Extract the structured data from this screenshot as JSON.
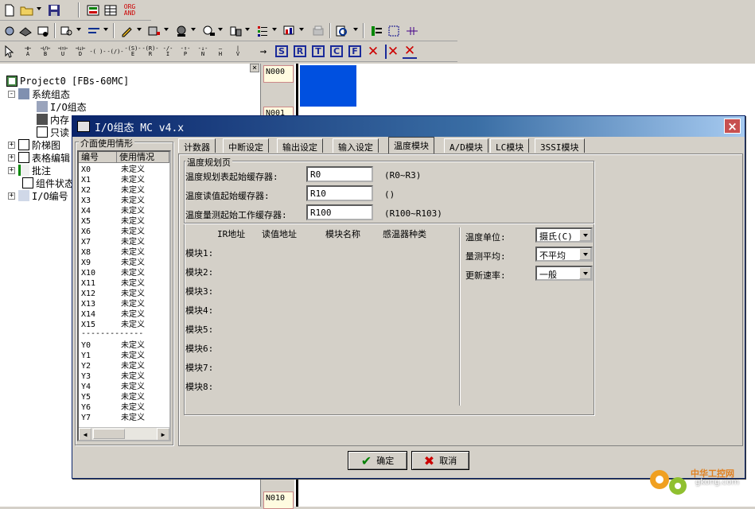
{
  "tree": {
    "project": "Project0 [FBs-60MC]",
    "items": [
      {
        "label": "系统组态",
        "expander": "-"
      },
      {
        "label": "I/O组态"
      },
      {
        "label": "内存"
      },
      {
        "label": "只读"
      },
      {
        "label": "阶梯图",
        "expander": "+"
      },
      {
        "label": "表格编辑",
        "expander": "+"
      },
      {
        "label": "批注",
        "expander": "+"
      },
      {
        "label": "组件状态"
      },
      {
        "label": "I/O编号",
        "expander": "+"
      }
    ],
    "close": "×"
  },
  "ladder": {
    "rungs": [
      "N000",
      "N001",
      "N010"
    ]
  },
  "toolbar": {
    "org_and_top": "ORG",
    "org_and_bottom": "AND",
    "ladder_buttons": [
      {
        "top": "⊣⊢",
        "bottom": "A"
      },
      {
        "top": "⊣/⊢",
        "bottom": "B"
      },
      {
        "top": "⊣↑⊢",
        "bottom": "U"
      },
      {
        "top": "⊣↓⊢",
        "bottom": "D"
      },
      {
        "top": "-( )-",
        "bottom": ""
      },
      {
        "top": "-(/)-",
        "bottom": ""
      },
      {
        "top": "-(S)-",
        "bottom": "E"
      },
      {
        "top": "-(R)-",
        "bottom": "R"
      },
      {
        "top": "-/-",
        "bottom": "I"
      },
      {
        "top": "-↑-",
        "bottom": "P"
      },
      {
        "top": "-↓-",
        "bottom": "N"
      },
      {
        "top": "—",
        "bottom": "H"
      },
      {
        "top": "|",
        "bottom": "V"
      },
      {
        "top": "→",
        "bottom": ""
      }
    ],
    "box_letters": [
      "S",
      "R",
      "T",
      "C",
      "F"
    ],
    "delete_marks": [
      "✕",
      "✕",
      "✕"
    ]
  },
  "dialog": {
    "title": "I/O组态 MC v4.x",
    "close": "×",
    "usage_group": "介面使用情形",
    "list_headers": [
      "编号",
      "使用情况"
    ],
    "x_rows": [
      [
        "X0",
        "未定义"
      ],
      [
        "X1",
        "未定义"
      ],
      [
        "X2",
        "未定义"
      ],
      [
        "X3",
        "未定义"
      ],
      [
        "X4",
        "未定义"
      ],
      [
        "X5",
        "未定义"
      ],
      [
        "X6",
        "未定义"
      ],
      [
        "X7",
        "未定义"
      ],
      [
        "X8",
        "未定义"
      ],
      [
        "X9",
        "未定义"
      ],
      [
        "X10",
        "未定义"
      ],
      [
        "X11",
        "未定义"
      ],
      [
        "X12",
        "未定义"
      ],
      [
        "X13",
        "未定义"
      ],
      [
        "X14",
        "未定义"
      ],
      [
        "X15",
        "未定义"
      ]
    ],
    "divider": "-------------",
    "y_rows": [
      [
        "Y0",
        "未定义"
      ],
      [
        "Y1",
        "未定义"
      ],
      [
        "Y2",
        "未定义"
      ],
      [
        "Y3",
        "未定义"
      ],
      [
        "Y4",
        "未定义"
      ],
      [
        "Y5",
        "未定义"
      ],
      [
        "Y6",
        "未定义"
      ],
      [
        "Y7",
        "未定义"
      ]
    ],
    "tabs": [
      "计数器",
      "中断设定",
      "输出设定",
      "输入设定",
      "温度模块",
      "A/D模块",
      "LC模块",
      "3SSI模块"
    ],
    "active_tab": "温度模块",
    "temp": {
      "group_label": "温度规划页",
      "fields": [
        {
          "label": "温度规划表起始缓存器:",
          "value": "R0",
          "hint": "(R0~R3)"
        },
        {
          "label": "温度读值起始缓存器:",
          "value": "R10",
          "hint": "()"
        },
        {
          "label": "温度量测起始工作缓存器:",
          "value": "R100",
          "hint": "(R100~R103)"
        }
      ],
      "module_headers": [
        "IR地址",
        "读值地址",
        "模块名称",
        "感温器种类"
      ],
      "modules": [
        "模块1:",
        "模块2:",
        "模块3:",
        "模块4:",
        "模块5:",
        "模块6:",
        "模块7:",
        "模块8:"
      ],
      "settings": [
        {
          "label": "温度单位:",
          "value": "摄氏(C)"
        },
        {
          "label": "量测平均:",
          "value": "不平均"
        },
        {
          "label": "更新速率:",
          "value": "一般"
        }
      ]
    },
    "ok": "确定",
    "cancel": "取消"
  },
  "watermark": {
    "name": "中华工控网",
    "url": "gkong.com"
  }
}
